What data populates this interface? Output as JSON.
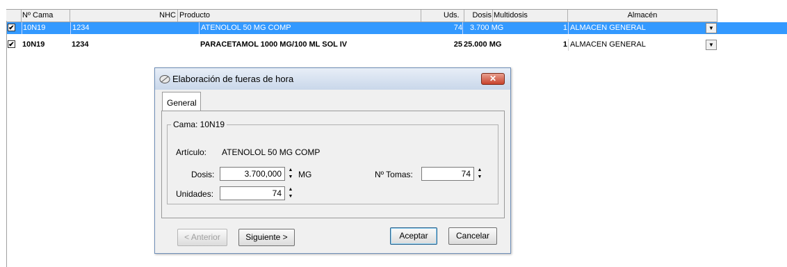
{
  "grid": {
    "columns": [
      "Nº Cama",
      "NHC",
      "Producto",
      "Uds.",
      "Dosis",
      "Multidosis",
      "Almacén"
    ],
    "rows": [
      {
        "checked": "✔",
        "cama": "10N19",
        "nhc": "1234",
        "producto": "ATENOLOL 50 MG COMP",
        "uds": "74",
        "dosis": "3.700 MG",
        "multidosis": "1",
        "almacen": "ALMACEN GENERAL",
        "selected": true
      },
      {
        "checked": "✔",
        "cama": "10N19",
        "nhc": "1234",
        "producto": "PARACETAMOL 1000 MG/100 ML SOL IV",
        "uds": "25",
        "dosis": "25.000 MG",
        "multidosis": "1",
        "almacen": "ALMACEN GENERAL",
        "selected": false
      }
    ],
    "colors": {
      "selection": "#3399ff"
    }
  },
  "dialog": {
    "title": "Elaboración de fueras de hora",
    "close_label": "✕",
    "tab_label": "General",
    "group_title": "Cama: 10N19",
    "articulo_label": "Artículo:",
    "articulo_value": "ATENOLOL 50 MG COMP",
    "dosis_label": "Dosis:",
    "dosis_value": "3.700,000",
    "dosis_unit": "MG",
    "tomas_label": "Nº Tomas:",
    "tomas_value": "74",
    "unidades_label": "Unidades:",
    "unidades_value": "74",
    "buttons": {
      "anterior": "< Anterior",
      "siguiente": "Siguiente >",
      "aceptar": "Aceptar",
      "cancelar": "Cancelar"
    }
  }
}
